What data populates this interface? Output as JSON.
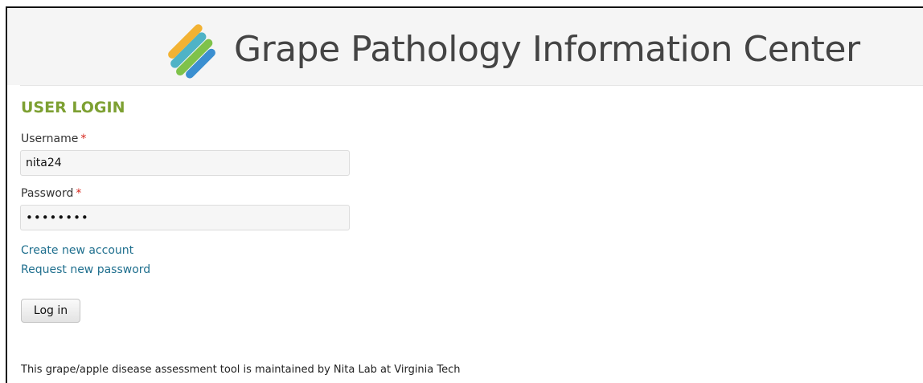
{
  "site": {
    "title": "Grape Pathology Information Center",
    "logo_icon": "grape-stripes-logo-icon",
    "logo_colors": [
      "#3b8fd0",
      "#7fc24a",
      "#f2b233",
      "#4fb3c6"
    ]
  },
  "login": {
    "heading": "USER LOGIN",
    "username_label": "Username",
    "username_value": "nita24",
    "password_label": "Password",
    "password_value": "••••••••",
    "required_marker": "*",
    "create_account_link": "Create new account",
    "request_password_link": "Request new password",
    "submit_label": "Log in"
  },
  "footer": {
    "text": "This grape/apple disease assessment tool is maintained by Nita Lab at Virginia Tech"
  },
  "colors": {
    "heading": "#7da032",
    "link": "#1f6f8e",
    "required": "#d6261c"
  }
}
